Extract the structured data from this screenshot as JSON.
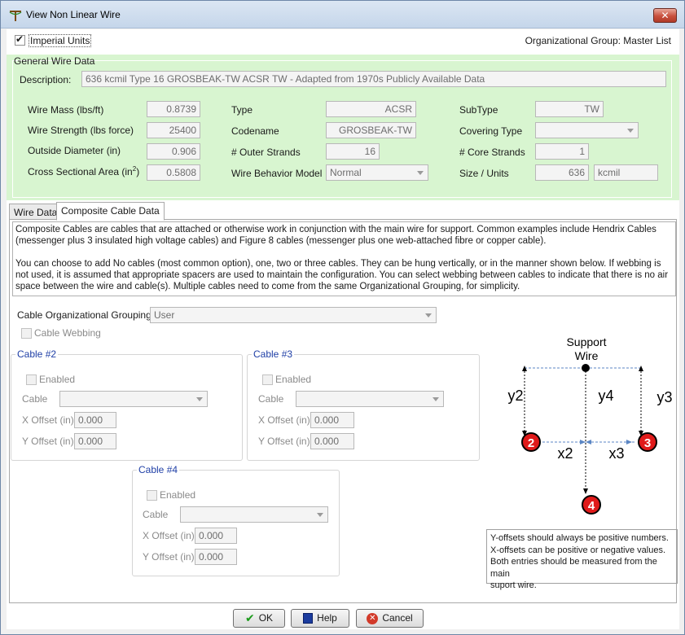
{
  "window": {
    "title": "View Non Linear Wire",
    "close_glyph": "✕"
  },
  "header": {
    "imperial_units_label": "Imperial Units",
    "imperial_checked": true,
    "org_group": "Organizational Group: Master List"
  },
  "general": {
    "group_title": "General Wire Data",
    "description_label": "Description:",
    "description_value": "636 kcmil Type 16 GROSBEAK-TW ACSR TW - Adapted from 1970s Publicly Available Data",
    "wire_mass_label": "Wire Mass (lbs/ft)",
    "wire_mass_value": "0.8739",
    "wire_strength_label": "Wire Strength (lbs force)",
    "wire_strength_value": "25400",
    "outside_diameter_label": "Outside Diameter (in)",
    "outside_diameter_value": "0.906",
    "cross_section_label_prefix": "Cross Sectional Area (in",
    "cross_section_sup": "2",
    "cross_section_label_suffix": ")",
    "cross_section_value": "0.5808",
    "type_label": "Type",
    "type_value": "ACSR",
    "codename_label": "Codename",
    "codename_value": "GROSBEAK-TW",
    "outer_strands_label": "# Outer Strands",
    "outer_strands_value": "16",
    "behavior_label": "Wire Behavior Model",
    "behavior_value": "Normal",
    "subtype_label": "SubType",
    "subtype_value": "TW",
    "covering_label": "Covering Type",
    "covering_value": "",
    "core_strands_label": "# Core Strands",
    "core_strands_value": "1",
    "size_units_label": "Size / Units",
    "size_value": "636",
    "units_value": "kcmil"
  },
  "tabs": [
    "Wire Data",
    "Composite Cable Data"
  ],
  "info": {
    "paragraph1": "Composite Cables are cables that are attached or otherwise work in conjunction with the main wire for support. Common examples include Hendrix Cables (messenger plus 3 insulated high voltage cables) and Figure 8 cables (messenger plus one web-attached fibre or copper cable).",
    "paragraph2": "You can choose to add No cables (most common option), one, two or three cables. They can be hung vertically, or in the manner shown below. If webbing is not used, it is assumed that appropriate spacers are used to maintain the configuration. You can select webbing between cables to indicate that there is no air space between the wire and cable(s). Multiple cables need to come from the same Organizational Grouping, for simplicity."
  },
  "cable_org": {
    "label": "Cable Organizational Grouping",
    "value": "User",
    "webbing_label": "Cable Webbing"
  },
  "cables": [
    {
      "title": "Cable #2",
      "enabled_label": "Enabled",
      "cable_label": "Cable",
      "x_label": "X Offset (in)",
      "x_value": "0.000",
      "y_label": "Y Offset (in)",
      "y_value": "0.000"
    },
    {
      "title": "Cable #3",
      "enabled_label": "Enabled",
      "cable_label": "Cable",
      "x_label": "X Offset (in)",
      "x_value": "0.000",
      "y_label": "Y Offset (in)",
      "y_value": "0.000"
    },
    {
      "title": "Cable #4",
      "enabled_label": "Enabled",
      "cable_label": "Cable",
      "x_label": "X Offset (in)",
      "x_value": "0.000",
      "y_label": "Y Offset (in)",
      "y_value": "0.000"
    }
  ],
  "diagram": {
    "support_line1": "Support",
    "support_line2": "Wire",
    "y2": "y2",
    "y4": "y4",
    "y3": "y3",
    "x2": "x2",
    "x3": "x3",
    "c2": "2",
    "c3": "3",
    "c4": "4"
  },
  "note": {
    "line1": "Y-offsets should always be positive numbers.",
    "line2": "X-offsets can be positive or negative values.",
    "line3": "Both entries should be measured from the main",
    "line4": "suport wire."
  },
  "buttons": {
    "ok": "OK",
    "help": "Help",
    "cancel": "Cancel"
  },
  "colors": {
    "green_panel": "#d8f5d0",
    "group_title": "#1f3fa6",
    "cable_red": "#e01a1a"
  }
}
